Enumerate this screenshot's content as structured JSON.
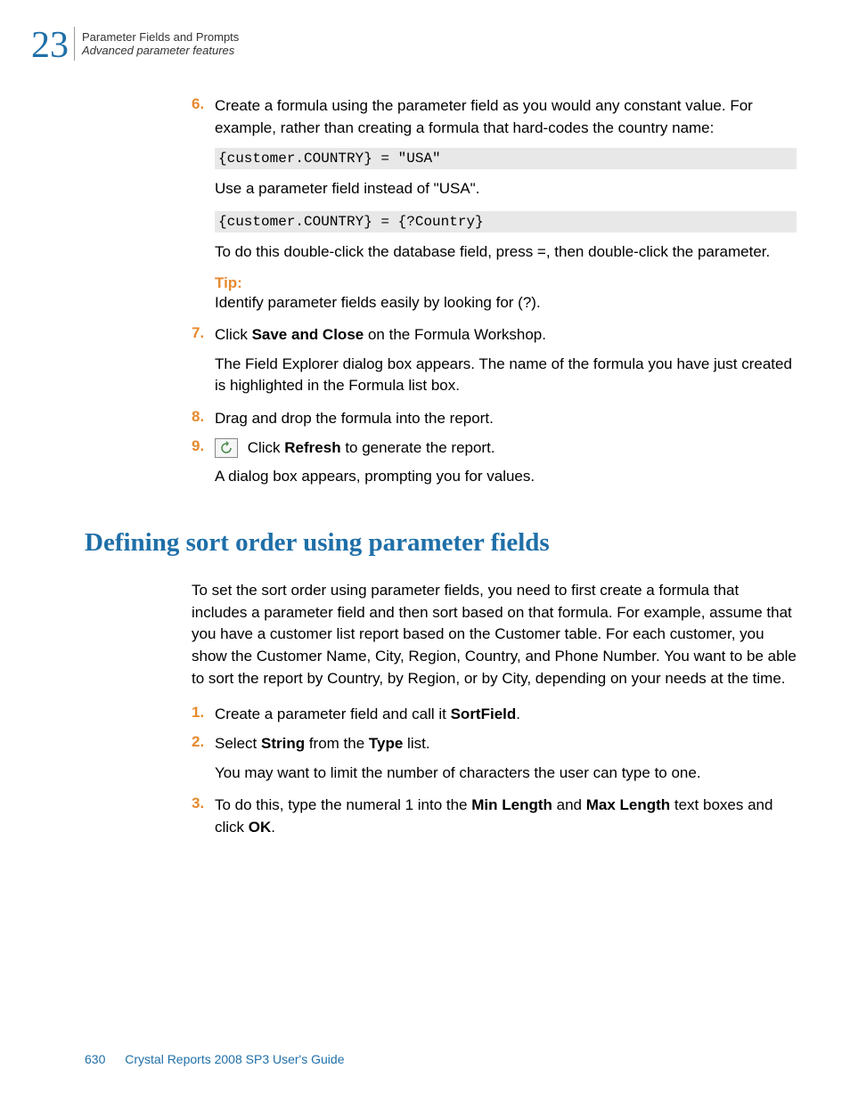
{
  "header": {
    "chapter_number": "23",
    "line1": "Parameter Fields and Prompts",
    "line2": "Advanced parameter features"
  },
  "steps_a": {
    "s6": {
      "num": "6.",
      "text": "Create a formula using the parameter field as you would any constant value. For example, rather than creating a formula that hard-codes the country name:"
    },
    "code1": "{customer.COUNTRY} = \"USA\"",
    "after_code1": "Use a parameter field instead of \"USA\".",
    "code2": "{customer.COUNTRY} = {?Country}",
    "after_code2": "To do this double-click the database field, press =, then double-click the parameter.",
    "tip_label": "Tip:",
    "tip_text": "Identify parameter fields easily by looking for (?).",
    "s7": {
      "num": "7.",
      "pre": "Click ",
      "bold": "Save and Close",
      "post": " on the Formula Workshop."
    },
    "s7_follow": "The Field Explorer dialog box appears. The name of the formula you have just created is highlighted in the Formula list box.",
    "s8": {
      "num": "8.",
      "text": "Drag and drop the formula into the report."
    },
    "s9": {
      "num": "9.",
      "pre": " Click ",
      "bold": "Refresh",
      "post": " to generate the report."
    },
    "s9_follow": "A dialog box appears, prompting you for values."
  },
  "section_heading": "Defining sort order using parameter fields",
  "section_intro": "To set the sort order using parameter fields, you need to first create a formula that includes a parameter field and then sort based on that formula. For example, assume that you have a customer list report based on the Customer table. For each customer, you show the Customer Name, City, Region, Country, and Phone Number. You want to be able to sort the report by Country, by Region, or by City, depending on your needs at the time.",
  "steps_b": {
    "s1": {
      "num": "1.",
      "pre": "Create a parameter field and call it ",
      "bold": "SortField",
      "post": "."
    },
    "s2": {
      "num": "2.",
      "pre": "Select ",
      "bold1": "String",
      "mid": " from the ",
      "bold2": "Type",
      "post": " list."
    },
    "s2_follow": "You may want to limit the number of characters the user can type to one.",
    "s3": {
      "num": "3.",
      "pre": "To do this, type the numeral 1 into the ",
      "bold1": "Min Length",
      "mid": " and ",
      "bold2": "Max Length",
      "post1": " text boxes and click ",
      "bold3": "OK",
      "post2": "."
    }
  },
  "footer": {
    "page_number": "630",
    "doc_title": "Crystal Reports 2008 SP3 User's Guide"
  }
}
